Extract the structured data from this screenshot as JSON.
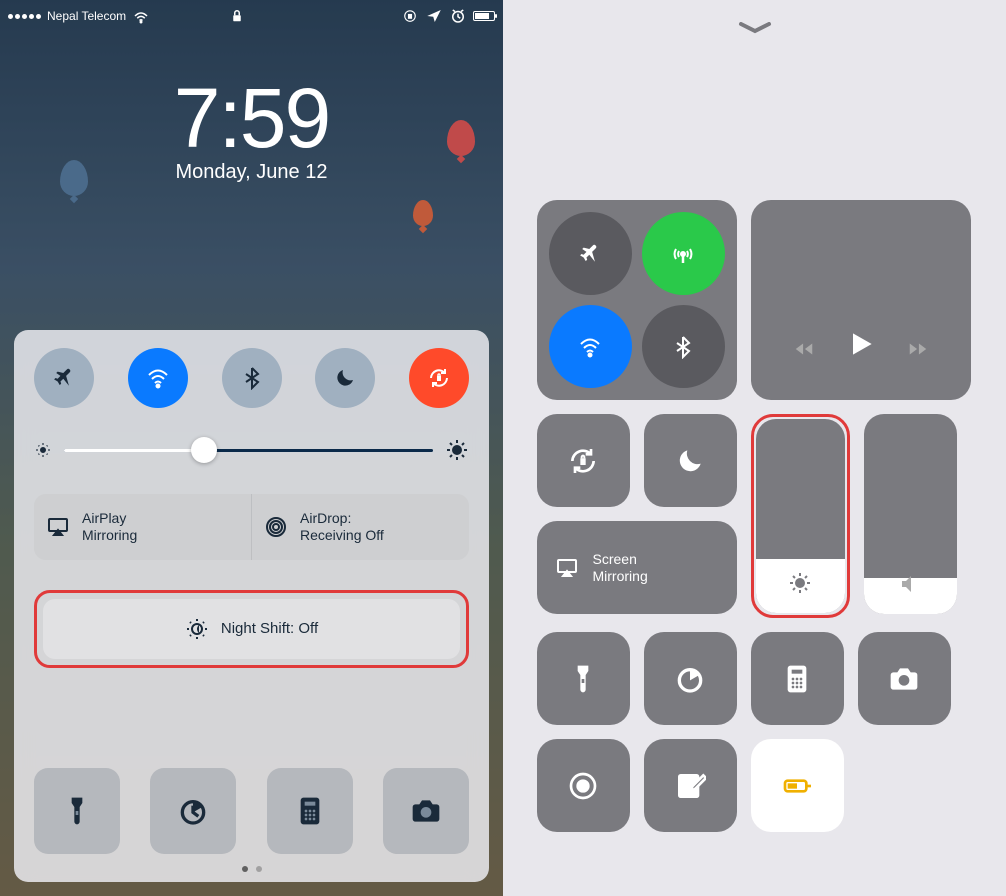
{
  "status": {
    "carrier": "Nepal Telecom"
  },
  "clock": {
    "time": "7:59",
    "date": "Monday, June 12"
  },
  "cc_left": {
    "airplay_l1": "AirPlay",
    "airplay_l2": "Mirroring",
    "airdrop_l1": "AirDrop:",
    "airdrop_l2": "Receiving Off",
    "nightshift": "Night Shift: Off"
  },
  "cc_right": {
    "mirror_l1": "Screen",
    "mirror_l2": "Mirroring"
  }
}
